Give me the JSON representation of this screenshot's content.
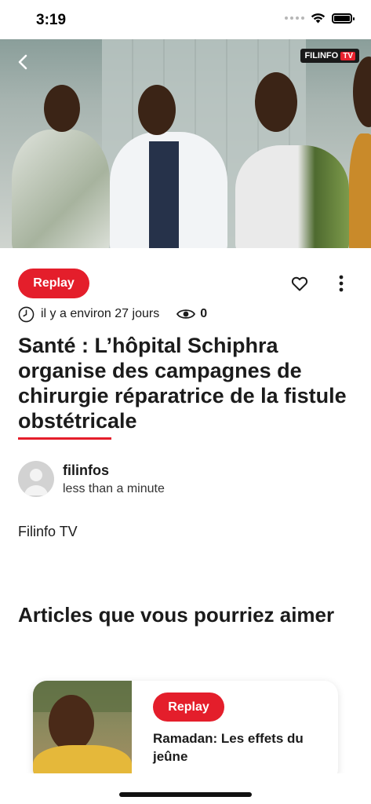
{
  "status_bar": {
    "time": "3:19"
  },
  "hero": {
    "channel_logo": "FILINFO",
    "channel_logo_tag": "TV"
  },
  "article": {
    "badge": "Replay",
    "published": "il y a environ 27 jours",
    "views": "0",
    "title": "Santé : L’hôpital Schiphra organise des campagnes de chirurgie réparatrice de la fistule obstétricale",
    "author": {
      "name": "filinfos",
      "read_time": "less than a minute"
    },
    "body": "Filinfo TV"
  },
  "related": {
    "heading": "Articles que vous pourriez aimer",
    "items": [
      {
        "badge": "Replay",
        "title": "Ramadan: Les effets du jeûne"
      }
    ]
  },
  "colors": {
    "accent": "#e41e2b",
    "text": "#1b1b1b"
  },
  "icons": [
    "back-arrow-icon",
    "heart-icon",
    "more-vertical-icon",
    "clock-icon",
    "eye-icon",
    "wifi-icon",
    "battery-icon"
  ]
}
